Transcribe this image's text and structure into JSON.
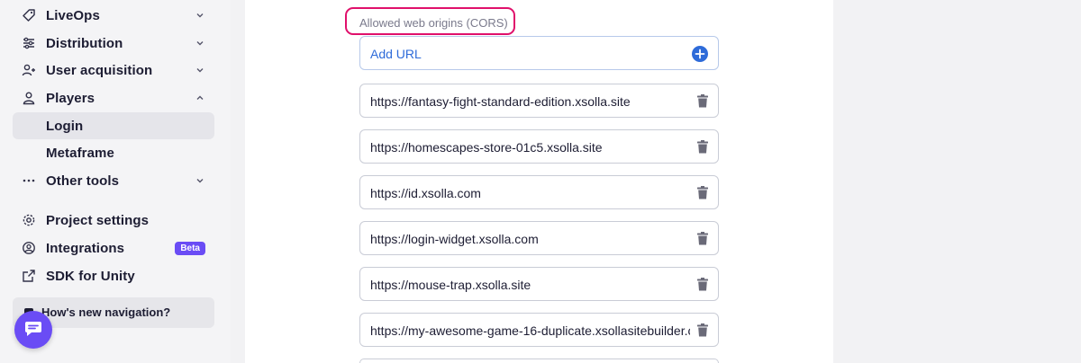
{
  "sidebar": {
    "items": [
      {
        "label": "LiveOps",
        "icon": "tag-icon",
        "chevron": "down"
      },
      {
        "label": "Distribution",
        "icon": "sliders-icon",
        "chevron": "down"
      },
      {
        "label": "User acquisition",
        "icon": "user-plus-icon",
        "chevron": "down"
      },
      {
        "label": "Players",
        "icon": "user-icon",
        "chevron": "up"
      },
      {
        "label": "Login",
        "active": true
      },
      {
        "label": "Metaframe"
      },
      {
        "label": "Other tools",
        "icon": "more-dots-icon",
        "chevron": "down"
      },
      {
        "label": "Project settings",
        "icon": "gear-icon"
      },
      {
        "label": "Integrations",
        "icon": "integrations-icon",
        "badge": "Beta"
      },
      {
        "label": "SDK for Unity",
        "icon": "external-link-icon"
      }
    ],
    "feedback_label": "How's new navigation?"
  },
  "cors": {
    "label": "Allowed web origins (CORS)",
    "add_label": "Add URL",
    "urls": [
      "https://fantasy-fight-standard-edition.xsolla.site",
      "https://homescapes-store-01c5.xsolla.site",
      "https://id.xsolla.com",
      "https://login-widget.xsolla.com",
      "https://mouse-trap.xsolla.site",
      "https://my-awesome-game-16-duplicate.xsollasitebuilder.c"
    ]
  },
  "colors": {
    "accent": "#6a4cf5",
    "link": "#2e6bd9",
    "highlight": "#e0106b"
  }
}
